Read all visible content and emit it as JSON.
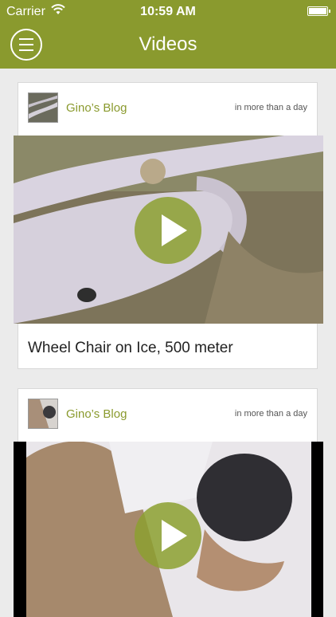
{
  "status_bar": {
    "carrier": "Carrier",
    "time": "10:59 AM"
  },
  "header": {
    "title": "Videos"
  },
  "posts": [
    {
      "blog": "Gino’s Blog",
      "time": "in more than a day",
      "title": "Wheel Chair on Ice, 500 meter"
    },
    {
      "blog": "Gino’s Blog",
      "time": "in more than a day",
      "title": ""
    }
  ],
  "colors": {
    "accent": "#8a9a2e",
    "background": "#ebebeb",
    "card": "#ffffff"
  },
  "icons": {
    "menu": "hamburger-icon",
    "play": "play-icon",
    "wifi": "wifi-icon",
    "battery": "battery-icon"
  }
}
